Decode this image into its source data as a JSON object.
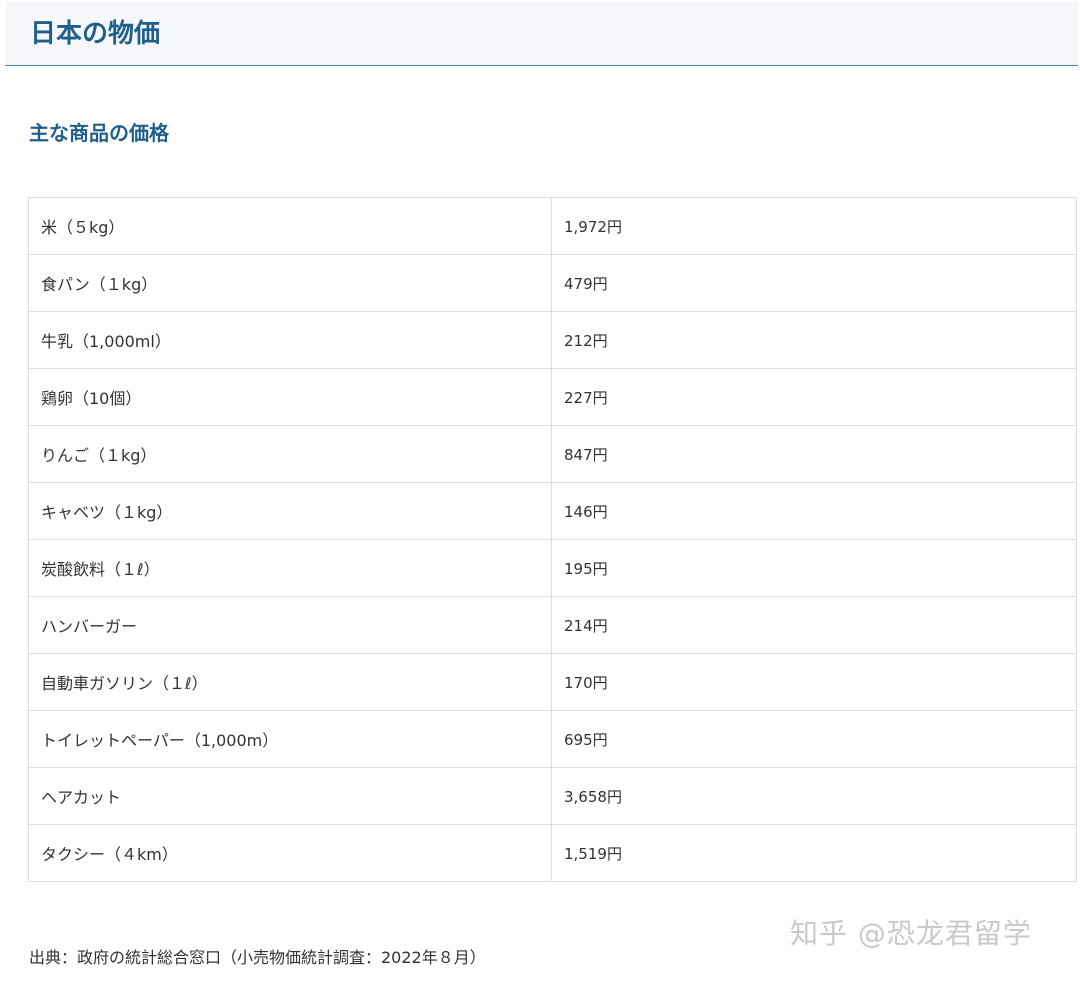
{
  "page": {
    "title": "日本の物価",
    "section_heading": "主な商品の価格",
    "source_note": "出典：政府の統計総合窓口（小売物価統計調査：2022年８月）",
    "watermark": "知乎 @恐龙君留学"
  },
  "colors": {
    "heading": "#1f5f8b",
    "header_background": "#f5f7fa",
    "header_border": "#4a8bb4",
    "table_border": "#dddddd",
    "text": "#333333",
    "watermark": "#c9c9c9"
  },
  "table": {
    "rows": [
      {
        "item": "米（５kg）",
        "price": "1,972円"
      },
      {
        "item": "食パン（１kg）",
        "price": "479円"
      },
      {
        "item": "牛乳（1,000ml）",
        "price": "212円"
      },
      {
        "item": "鶏卵（10個）",
        "price": "227円"
      },
      {
        "item": "りんご（１kg）",
        "price": "847円"
      },
      {
        "item": "キャベツ（１kg）",
        "price": "146円"
      },
      {
        "item": "炭酸飲料（１ℓ）",
        "price": "195円"
      },
      {
        "item": "ハンバーガー",
        "price": "214円"
      },
      {
        "item": "自動車ガソリン（１ℓ）",
        "price": "170円"
      },
      {
        "item": "トイレットペーパー（1,000m）",
        "price": "695円"
      },
      {
        "item": "ヘアカット",
        "price": "3,658円"
      },
      {
        "item": "タクシー（４km）",
        "price": "1,519円"
      }
    ]
  }
}
